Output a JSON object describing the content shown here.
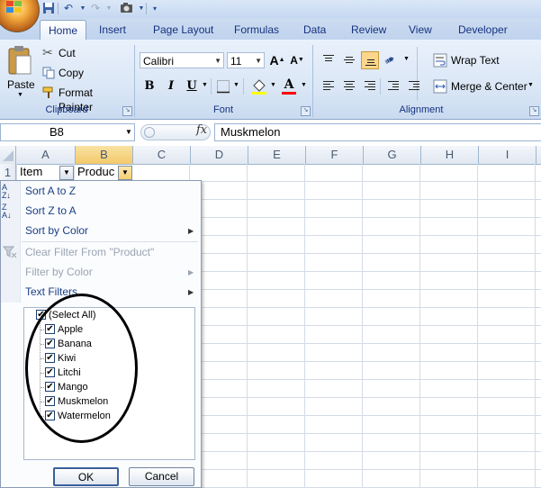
{
  "ribbon_tabs": [
    "Home",
    "Insert",
    "Page Layout",
    "Formulas",
    "Data",
    "Review",
    "View",
    "Developer"
  ],
  "clipboard": {
    "paste": "Paste",
    "cut": "Cut",
    "copy": "Copy",
    "format_painter": "Format Painter",
    "group_label": "Clipboard"
  },
  "font": {
    "name": "Calibri",
    "size": "11",
    "bold": "B",
    "italic": "I",
    "underline": "U",
    "grow": "A",
    "shrink": "A",
    "font_color_letter": "A",
    "group_label": "Font",
    "fill_color": "#ffff00",
    "font_color": "#ff0000"
  },
  "alignment": {
    "wrap_text": "Wrap Text",
    "merge_center": "Merge & Center",
    "group_label": "Alignment"
  },
  "formula_bar": {
    "name_box": "B8",
    "fx": "fx",
    "value": "Muskmelon"
  },
  "grid": {
    "columns": [
      "A",
      "B",
      "C",
      "D",
      "E",
      "F",
      "G",
      "H",
      "I"
    ],
    "rows": [
      "1"
    ],
    "cells": {
      "A1": "Item",
      "B1": "Produc"
    }
  },
  "filter_menu": {
    "sort_a_z": "Sort A to Z",
    "sort_z_a": "Sort Z to A",
    "sort_by_color": "Sort by Color",
    "clear_filter": "Clear Filter From \"Product\"",
    "filter_by_color": "Filter by Color",
    "text_filters": "Text Filters",
    "items": [
      {
        "label": "(Select All)",
        "checked": true
      },
      {
        "label": "Apple",
        "checked": true
      },
      {
        "label": "Banana",
        "checked": true
      },
      {
        "label": "Kiwi",
        "checked": true
      },
      {
        "label": "Litchi",
        "checked": true
      },
      {
        "label": "Mango",
        "checked": true
      },
      {
        "label": "Muskmelon",
        "checked": true
      },
      {
        "label": "Watermelon",
        "checked": true
      }
    ],
    "ok": "OK",
    "cancel": "Cancel"
  }
}
